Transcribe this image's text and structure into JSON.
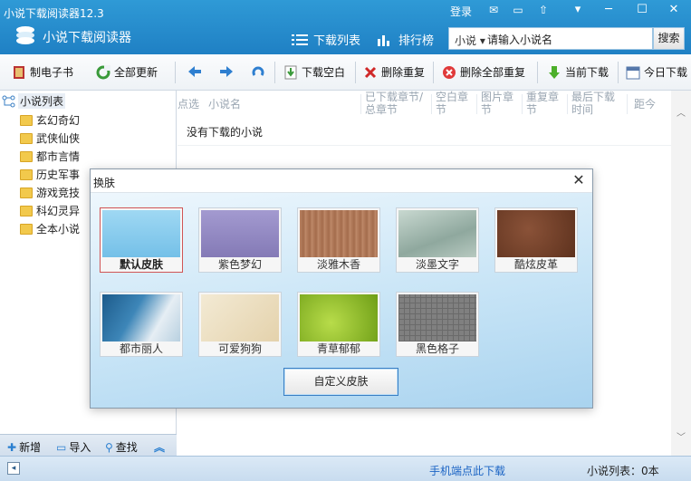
{
  "window": {
    "app_title": "小说下载阅读器12.3",
    "brand": "小说下载阅读器",
    "login": "登录",
    "icons": [
      "mail-icon",
      "chat-icon",
      "upload-icon",
      "dropdown-menu-icon",
      "minimize-icon",
      "maximize-icon",
      "close-icon"
    ]
  },
  "nav": {
    "download_list": "下载列表",
    "ranking": "排行榜"
  },
  "search": {
    "scope": "小说",
    "value": "请输入小说名",
    "button": "搜索"
  },
  "toolbar": {
    "make_ebook": "制电子书",
    "update_all": "全部更新",
    "download_blank": "下载空白",
    "delete_dup": "删除重复",
    "delete_all_dup": "删除全部重复",
    "current_download": "当前下载",
    "today_download": "今日下载"
  },
  "sidebar": {
    "root": "小说列表",
    "items": [
      "玄幻奇幻",
      "武侠仙侠",
      "都市言情",
      "历史军事",
      "游戏竞技",
      "科幻灵异",
      "全本小说"
    ],
    "bottom": {
      "add": "新增",
      "import": "导入",
      "find": "查找"
    }
  },
  "table": {
    "columns": [
      "点选",
      "小说名",
      "已下载章节/总章节",
      "空白章节",
      "图片章节",
      "重复章节",
      "最后下载时间",
      "距今"
    ],
    "empty_message": "没有下载的小说"
  },
  "statusbar": {
    "mobile_link": "手机端点此下载",
    "list_count": "小说列表：0本"
  },
  "dialog": {
    "title": "换肤",
    "skins": [
      {
        "name": "默认皮肤",
        "selected": true,
        "color": "#8fd0ee"
      },
      {
        "name": "紫色梦幻",
        "selected": false,
        "color": "#9187c0"
      },
      {
        "name": "淡雅木香",
        "selected": false,
        "color": "#b0785a"
      },
      {
        "name": "淡墨文字",
        "selected": false,
        "color": "#9fb8b0"
      },
      {
        "name": "酷炫皮革",
        "selected": false,
        "color": "#7a4630"
      },
      {
        "name": "都市丽人",
        "selected": false,
        "color": "#2a6ea0"
      },
      {
        "name": "可爱狗狗",
        "selected": false,
        "color": "#ece0c4"
      },
      {
        "name": "青草郁郁",
        "selected": false,
        "color": "#86b824"
      },
      {
        "name": "黑色格子",
        "selected": false,
        "color": "#7a7a7a"
      }
    ],
    "custom_button": "自定义皮肤"
  }
}
